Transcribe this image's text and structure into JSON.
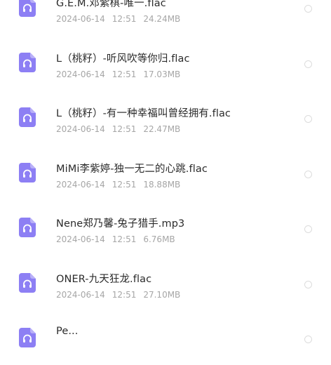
{
  "colors": {
    "icon_bg": "#8d7ff4",
    "icon_fold": "#b9b0f8",
    "name_text": "#2b2b2b",
    "meta_text": "#a6a6a6",
    "radio_border": "#dcdcdc"
  },
  "files": [
    {
      "name": "G.E.M.邓紫棋-唯一.flac",
      "date": "2024-06-14",
      "time": "12:51",
      "size": "24.24MB",
      "icon": "audio-file-headphones-icon"
    },
    {
      "name": "L（桃籽）-听风吹等你归.flac",
      "date": "2024-06-14",
      "time": "12:51",
      "size": "17.03MB",
      "icon": "audio-file-headphones-icon"
    },
    {
      "name": "L（桃籽）-有一种幸福叫曾经拥有.flac",
      "date": "2024-06-14",
      "time": "12:51",
      "size": "22.47MB",
      "icon": "audio-file-headphones-icon"
    },
    {
      "name": "MiMi李紫婷-独一无二的心跳.flac",
      "date": "2024-06-14",
      "time": "12:51",
      "size": "18.88MB",
      "icon": "audio-file-headphones-icon"
    },
    {
      "name": "Nene郑乃馨-兔子猎手.mp3",
      "date": "2024-06-14",
      "time": "12:51",
      "size": "6.76MB",
      "icon": "audio-file-headphones-icon"
    },
    {
      "name": "ONER-九天狂龙.flac",
      "date": "2024-06-14",
      "time": "12:51",
      "size": "27.10MB",
      "icon": "audio-file-headphones-icon"
    },
    {
      "name": "Pe...",
      "date": "",
      "time": "",
      "size": "",
      "icon": "audio-file-headphones-icon"
    }
  ]
}
